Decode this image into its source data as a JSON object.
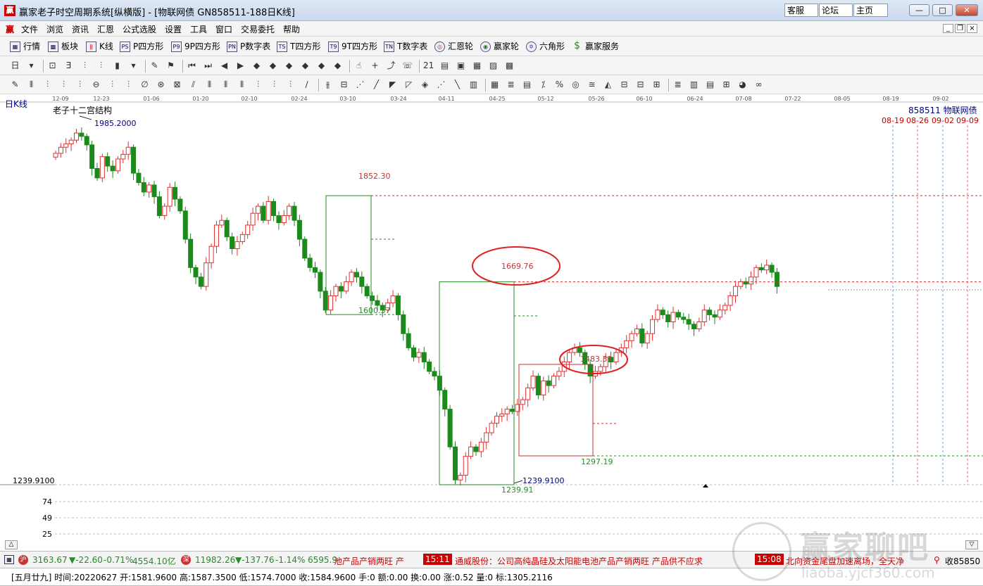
{
  "titlebar": {
    "app_icon_char": "赢",
    "title": "赢家老子时空周期系统[纵横版] - [物联网债  GN858511-188日K线]",
    "links": [
      "客服",
      "论坛",
      "主页"
    ],
    "win_buttons": [
      "—",
      "□",
      "✕"
    ]
  },
  "menubar": {
    "app_icon_char": "赢",
    "items": [
      "文件",
      "浏览",
      "资讯",
      "汇恩",
      "公式选股",
      "设置",
      "工具",
      "窗口",
      "交易委托",
      "帮助"
    ],
    "mdi_buttons": [
      "_",
      "❐",
      "×"
    ]
  },
  "toolbar1": {
    "items": [
      {
        "label": "行情",
        "icon": "grid-icon",
        "glyph": "▦"
      },
      {
        "label": "板块",
        "icon": "blocks-icon",
        "glyph": "▩"
      },
      {
        "label": "K线",
        "icon": "candles-icon",
        "glyph": "ǀǀ"
      },
      {
        "label": "P四方形",
        "icon": "ps-icon",
        "glyph": "PS"
      },
      {
        "label": "9P四方形",
        "icon": "p9-icon",
        "glyph": "P9"
      },
      {
        "label": "P数字表",
        "icon": "pn-icon",
        "glyph": "PN"
      },
      {
        "label": "T四方形",
        "icon": "ts-icon",
        "glyph": "TS"
      },
      {
        "label": "9T四方形",
        "icon": "t9-icon",
        "glyph": "T9"
      },
      {
        "label": "T数字表",
        "icon": "tn-icon",
        "glyph": "TN"
      },
      {
        "label": "汇恩轮",
        "icon": "wheel-icon",
        "glyph": "◎"
      },
      {
        "label": "赢家轮",
        "icon": "win-wheel-icon",
        "glyph": "◉"
      },
      {
        "label": "六角形",
        "icon": "hexagon-icon",
        "glyph": "✡"
      },
      {
        "label": "赢家服务",
        "icon": "dollar-icon",
        "glyph": "$"
      }
    ]
  },
  "toolbar2": {
    "glyphs": [
      "日",
      "▾",
      "⊡",
      "Ǝ",
      "⫶",
      "⫶",
      "▮",
      "▾",
      "✎",
      "⚑",
      "⏮",
      "⏭",
      "◀",
      "▶",
      "◆",
      "◆",
      "◆",
      "◆",
      "◆",
      "◆",
      "☝",
      "+",
      "⤴",
      "☏",
      "21",
      "▤",
      "▣",
      "▦",
      "▨",
      "▩"
    ]
  },
  "toolbar3": {
    "glyphs": [
      "✎",
      "⫴",
      "⫶",
      "⫶",
      "⫶",
      "⊖",
      "⫶",
      "⫶",
      "∅",
      "⊛",
      "⊠",
      "⫽",
      "⫴",
      "⫴",
      "⫴",
      "⫶",
      "⫶",
      "⫶",
      "∕",
      "⫵",
      "⊟",
      "⋰",
      "╱",
      "◤",
      "◸",
      "◈",
      "⋰",
      "╲",
      "▥",
      "▦",
      "≣",
      "▤",
      "⁒",
      "%",
      "◎",
      "≊",
      "◭",
      "⊟",
      "⊟",
      "⊞",
      "≣",
      "▥",
      "▤",
      "⊞",
      "◕",
      "∞"
    ]
  },
  "chart": {
    "period_label": "日K线",
    "indicator_title": "老子十二宫结构",
    "security": "858511  物联网债",
    "base_price_label": "1239.9100",
    "x_dates": [
      "12-09",
      "12-23",
      "01-06",
      "01-20",
      "02-10",
      "02-24",
      "03-10",
      "03-24",
      "04-11",
      "04-25",
      "05-12",
      "05-26",
      "06-10",
      "06-24",
      "07-08",
      "07-22",
      "08-05",
      "08-19",
      "09-02"
    ],
    "future_dates": [
      "08-19",
      "08-26",
      "09-02",
      "09-09"
    ],
    "annotations": {
      "high_start": "1985.2000",
      "peak_1": "1852.30",
      "low_1": "1600.37",
      "peak_2": "1669.76",
      "peak_3": "1483.31",
      "low_3": "1297.19",
      "low_2": "1239.91",
      "low_marker": "1239.9100"
    },
    "lower_ticks": [
      "74",
      "49",
      "25"
    ],
    "colors": {
      "up": "#e03030",
      "down": "#1a8a1a",
      "level_red": "#c83232",
      "level_green": "#2a8a2a",
      "circle": "#e02020",
      "date_future": "#c00000"
    }
  },
  "chart_data": {
    "type": "candlestick",
    "title": "老子十二宫结构",
    "x_ticks": [
      "12-09",
      "12-23",
      "01-06",
      "01-20",
      "02-10",
      "02-24",
      "03-10",
      "03-24",
      "04-11",
      "04-25",
      "05-12",
      "05-26",
      "06-10",
      "06-24",
      "07-08",
      "07-22",
      "08-05",
      "08-19",
      "09-02"
    ],
    "key_levels": [
      {
        "label": "1985.2000",
        "value": 1985.2
      },
      {
        "label": "1852.30",
        "value": 1852.3
      },
      {
        "label": "1669.76",
        "value": 1669.76
      },
      {
        "label": "1600.37",
        "value": 1600.37
      },
      {
        "label": "1483.31",
        "value": 1483.31
      },
      {
        "label": "1297.19",
        "value": 1297.19
      },
      {
        "label": "1239.91",
        "value": 1239.91
      }
    ],
    "closes": [
      1942,
      1955,
      1962,
      1970,
      1985,
      1978,
      1960,
      1910,
      1890,
      1935,
      1915,
      1905,
      1930,
      1940,
      1955,
      1900,
      1880,
      1860,
      1875,
      1850,
      1810,
      1830,
      1870,
      1845,
      1820,
      1760,
      1700,
      1680,
      1660,
      1710,
      1745,
      1790,
      1800,
      1765,
      1740,
      1755,
      1770,
      1790,
      1815,
      1830,
      1800,
      1840,
      1810,
      1795,
      1810,
      1830,
      1800,
      1760,
      1720,
      1700,
      1690,
      1650,
      1610,
      1640,
      1660,
      1650,
      1670,
      1690,
      1680,
      1660,
      1640,
      1630,
      1620,
      1610,
      1625,
      1640,
      1600,
      1560,
      1530,
      1510,
      1520,
      1500,
      1480,
      1470,
      1440,
      1400,
      1320,
      1250,
      1260,
      1300,
      1320,
      1310,
      1330,
      1350,
      1370,
      1385,
      1390,
      1400,
      1395,
      1410,
      1420,
      1445,
      1470,
      1430,
      1460,
      1450,
      1470,
      1480,
      1500,
      1520,
      1530,
      1520,
      1495,
      1470,
      1480,
      1490,
      1510,
      1500,
      1520,
      1530,
      1545,
      1560,
      1570,
      1540,
      1560,
      1590,
      1610,
      1600,
      1585,
      1605,
      1595,
      1590,
      1580,
      1570,
      1585,
      1610,
      1600,
      1595,
      1610,
      1620,
      1640,
      1660,
      1670,
      1665,
      1680,
      1700,
      1695,
      1705,
      1690,
      1660
    ]
  },
  "statusbar": {
    "sh_value": "3163.67",
    "sh_change": "▼-22.60",
    "sh_pct": "-0.71%",
    "sh_amount": "4554.10亿",
    "sz_value": "11982.26",
    "sz_change": "▼-137.76",
    "sz_pct": "-1.14%",
    "sz_amount": "6595.9",
    "news_tail": "池产品产销两旺 产",
    "news_time_1": "15:11",
    "news_1": "通威股份：公司高纯晶硅及太阳能电池产品产销两旺 产品供不应求",
    "news_time_2": "15:08",
    "news_2": "北向资金尾盘加速离场，全天净",
    "right_label": "收85850"
  },
  "infobar": {
    "text": "[五月廿九] 时间:20220627 开:1581.9600 高:1587.3500 低:1574.7000 收:1584.9600 手:0 额:0.00 换:0.00 涨:0.52 量:0 标:1305.2116"
  },
  "watermark": {
    "text": "赢家聊吧",
    "url": "liaoba.yjcf360.com"
  }
}
